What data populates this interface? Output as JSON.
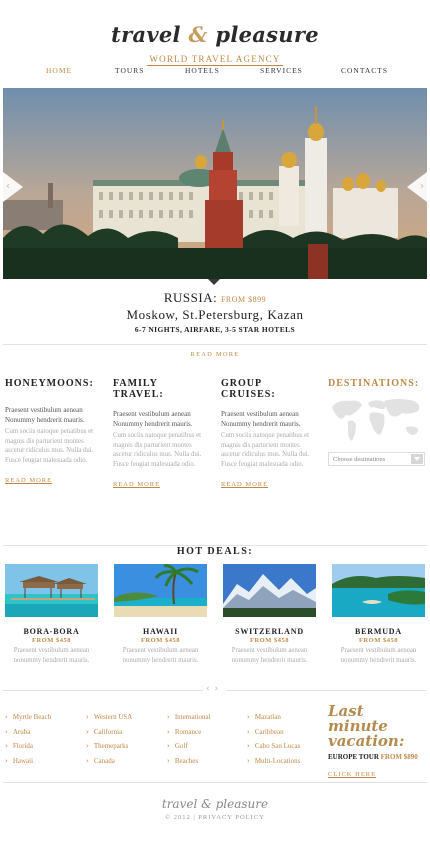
{
  "brand": {
    "name_part1": "travel",
    "amp": "&",
    "name_part2": "pleasure",
    "tagline": "WORLD TRAVEL AGENCY"
  },
  "nav": [
    "HOME",
    "TOURS",
    "HOTELS",
    "SERVICES",
    "CONTACTS"
  ],
  "nav_active": "HOME",
  "slider": {
    "country": "RUSSIA:",
    "from": "FROM $899",
    "cities": "Moskow, St.Petersburg, Kazan",
    "details": "6-7 NIGHTS, AIRFARE, 3-5 STAR HOTELS",
    "read_more": "READ MORE",
    "prev_icon": "chevron-left-icon",
    "next_icon": "chevron-right-icon"
  },
  "columns": [
    {
      "title": "HONEYMOONS:",
      "lead": "Praesent vestibulum aenean Nonummy hendrerit mauris.",
      "body": "Cum sociis natoque penatibus et magnis dis parturient montes ascetur ridiculus mus. Nulla dui. Fusce feugiat malesuada odio.",
      "read_more": "READ MORE"
    },
    {
      "title": "FAMILY TRAVEL:",
      "lead": "Praesent vestibulum aenean Nonummy hendrerit mauris.",
      "body": "Cum sociis natoque penatibus et magnis dis parturient montes ascetur ridiculus mus. Nulla dui. Fusce feugiat malesuada odio.",
      "read_more": "READ MORE"
    },
    {
      "title": "GROUP CRUISES:",
      "lead": "Praesent vestibulum aenean Nonummy hendrerit mauris.",
      "body": "Cum sociis natoque penatibus et magnis dis parturient montes ascetur ridiculus mus. Nulla dui. Fusce feugiat malesuada odio.",
      "read_more": "READ MORE"
    }
  ],
  "destinations": {
    "title": "DESTINATIONS:",
    "select_placeholder": "Choose destinations"
  },
  "hot_deals": {
    "title": "HOT DEALS:",
    "items": [
      {
        "name": "BORA-BORA",
        "price": "FROM $458",
        "desc": "Praesent vestibulum aenean nonummy hendrerit mauris."
      },
      {
        "name": "HAWAII",
        "price": "FROM $458",
        "desc": "Praesent vestibulum aenean nonummy hendrerit mauris."
      },
      {
        "name": "SWITZERLAND",
        "price": "FROM $458",
        "desc": "Praesent vestibulum aenean nonummy hendrerit mauris."
      },
      {
        "name": "BERMUDA",
        "price": "FROM $458",
        "desc": "Praesent vestibulum aenean nonummy hendrerit mauris."
      }
    ]
  },
  "link_lists": [
    [
      "Myrtle Beach",
      "Aruba",
      "Florida",
      "Hawaii"
    ],
    [
      "Western USA",
      "California",
      "Themeparks",
      "Canada"
    ],
    [
      "International",
      "Romance",
      "Golf",
      "Beaches"
    ],
    [
      "Mazatlan",
      "Caribbean",
      "Cabo San Lucas",
      "Multi-Locations"
    ]
  ],
  "last_minute": {
    "title_line1": "Last minute",
    "title_line2": "vacation:",
    "tour": "EUROPE TOUR",
    "price": "FROM $890",
    "click": "CLICK HERE"
  },
  "footer": {
    "logo": "travel & pleasure",
    "copyright": "© 2012",
    "separator": "|",
    "privacy": "PRIVACY POLICY"
  },
  "colors": {
    "accent": "#c08a46",
    "text": "#222222",
    "muted": "#aaaaaa"
  }
}
